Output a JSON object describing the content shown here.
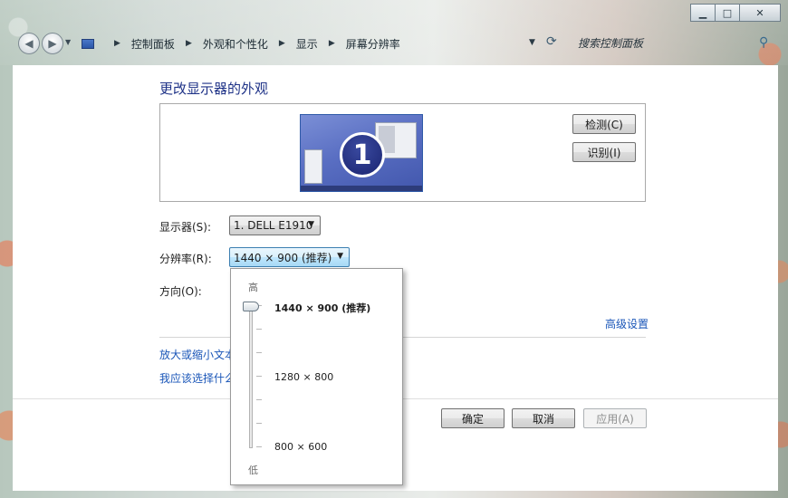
{
  "window": {
    "caption_buttons": {
      "minimize": "▁",
      "maximize": "□",
      "close": "✕"
    }
  },
  "navigation": {
    "back_icon": "back-arrow-icon",
    "forward_icon": "forward-arrow-icon",
    "breadcrumb": [
      "控制面板",
      "外观和个性化",
      "显示",
      "屏幕分辨率"
    ],
    "search_placeholder": "搜索控制面板"
  },
  "main": {
    "title": "更改显示器的外观",
    "monitor_number": "1",
    "detect_button": "检测(C)",
    "identify_button": "识别(I)",
    "display_label": "显示器(S):",
    "display_value": "1. DELL E1910",
    "resolution_label": "分辨率(R):",
    "resolution_value": "1440 × 900 (推荐)",
    "orientation_label": "方向(O):",
    "advanced_link": "高级设置",
    "enlarge_link": "放大或缩小文本",
    "choose_link": "我应该选择什么"
  },
  "footer": {
    "ok_button": "确定",
    "cancel_button": "取消",
    "apply_button": "应用(A)"
  },
  "resolution_popup": {
    "high_label": "高",
    "low_label": "低",
    "options": [
      "1440 × 900 (推荐)",
      "1280 × 800",
      "800 × 600"
    ],
    "slider_level": 1.0
  }
}
